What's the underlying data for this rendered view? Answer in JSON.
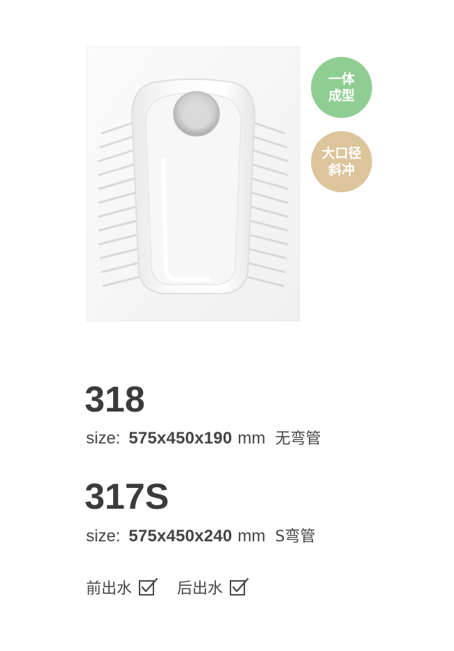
{
  "product_image": {
    "icon": "squat-toilet-photo"
  },
  "badges": [
    {
      "line1": "一体",
      "line2": "成型",
      "color": "#8fce92"
    },
    {
      "line1": "大口径",
      "line2": "斜冲",
      "color": "#dcc49b"
    }
  ],
  "models": [
    {
      "name": "318",
      "size_label": "size",
      "size_colon": ":",
      "dimensions": "575x450x190",
      "unit": "mm",
      "note": "无弯管"
    },
    {
      "name": "317S",
      "size_label": "size",
      "size_colon": ":",
      "dimensions": "575x450x240",
      "unit": "mm",
      "note": "S弯管"
    }
  ],
  "outlets": [
    {
      "label": "前出水",
      "checked": true,
      "icon": "checkbox-checked-icon"
    },
    {
      "label": "后出水",
      "checked": true,
      "icon": "checkbox-checked-icon"
    }
  ],
  "colors": {
    "text": "#3b3b3b",
    "badge_green": "#8fce92",
    "badge_tan": "#dcc49b"
  }
}
